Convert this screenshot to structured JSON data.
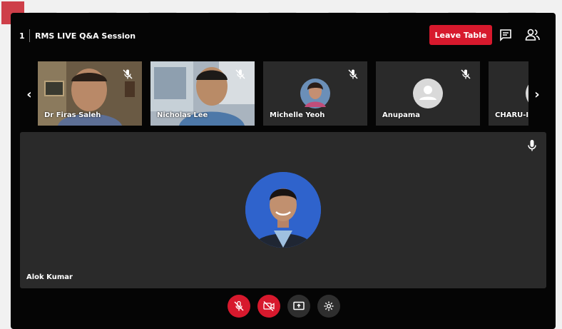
{
  "session": {
    "table_number": "1",
    "title": "RMS LIVE Q&A Session",
    "leave_label": "Leave Table"
  },
  "participants": [
    {
      "name": "Dr Firas Saleh",
      "muted": true,
      "video": "on"
    },
    {
      "name": "Nicholas Lee",
      "muted": true,
      "video": "on"
    },
    {
      "name": "Michelle Yeoh",
      "muted": true,
      "video": "avatar-photo"
    },
    {
      "name": "Anupama",
      "muted": true,
      "video": "avatar-placeholder"
    },
    {
      "name": "CHARU-I",
      "muted": false,
      "video": "avatar-placeholder"
    }
  ],
  "active_speaker": {
    "name": "Alok Kumar",
    "mic": "on"
  },
  "controls": [
    {
      "icon": "mic-off-icon",
      "state": "off"
    },
    {
      "icon": "camera-off-icon",
      "state": "off"
    },
    {
      "icon": "screen-share-icon",
      "state": "neutral"
    },
    {
      "icon": "settings-icon",
      "state": "neutral"
    }
  ],
  "colors": {
    "accent": "#d7192d",
    "modal_bg": "#050505",
    "tile_bg": "#2a2a2a"
  }
}
